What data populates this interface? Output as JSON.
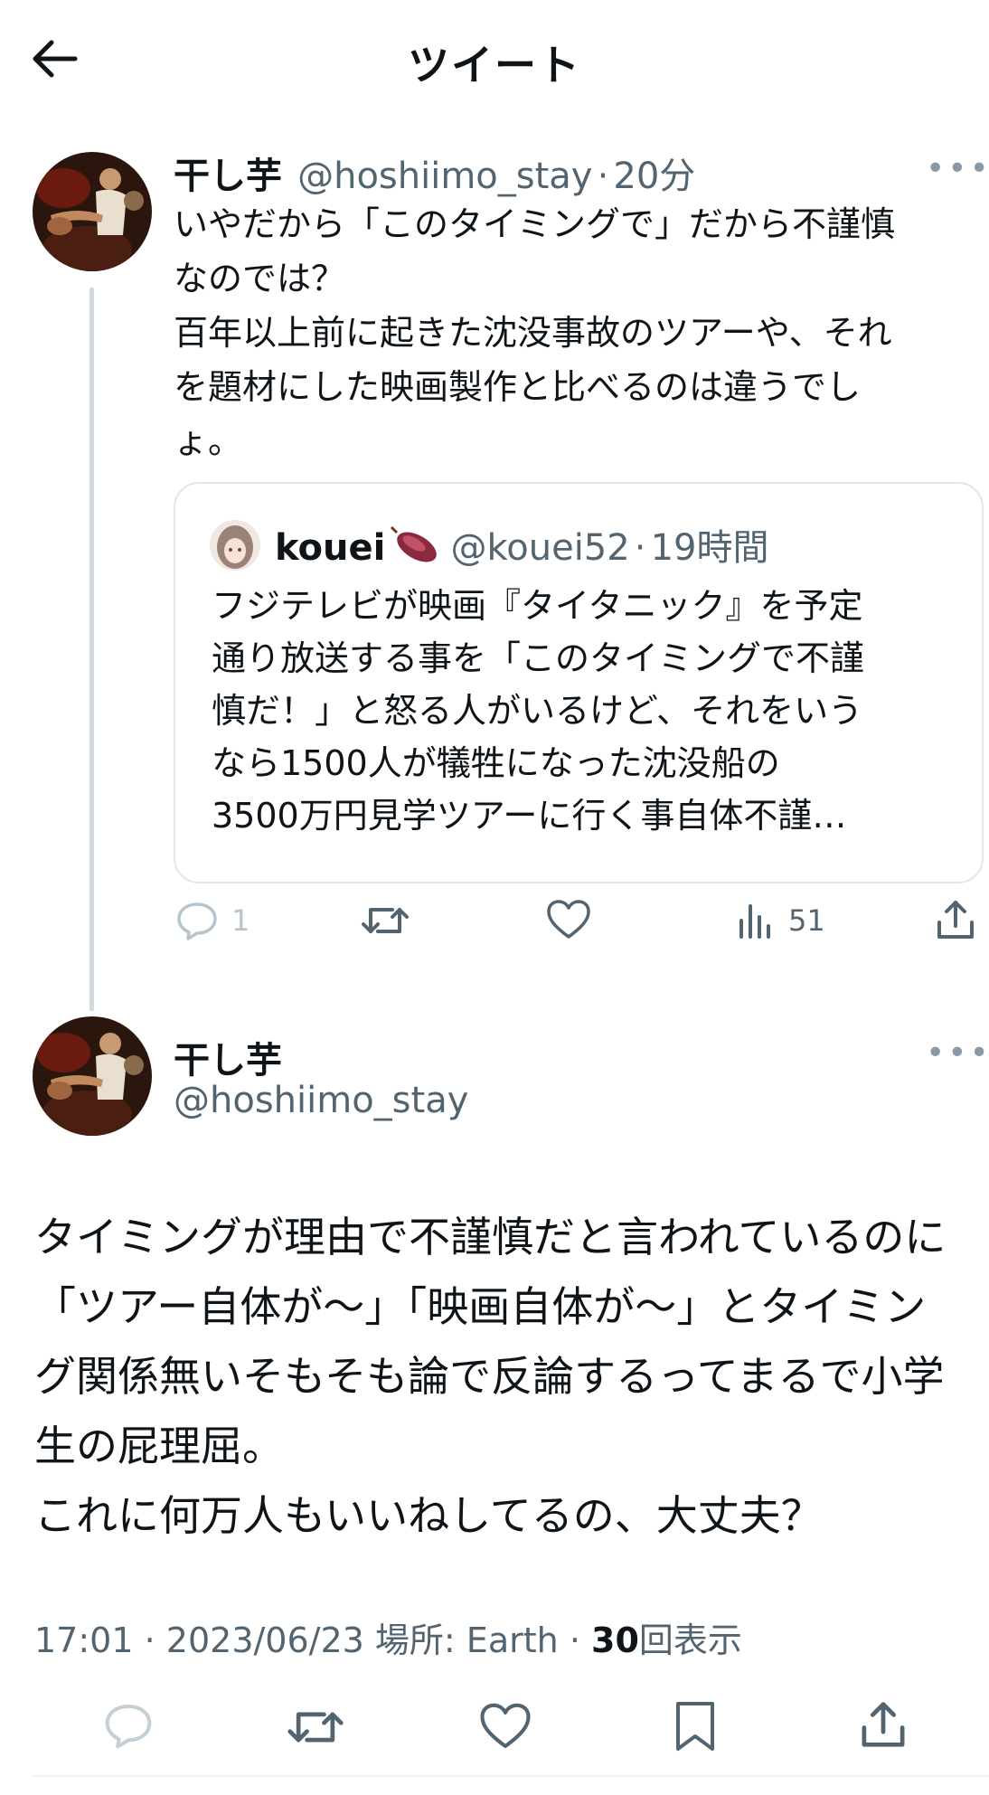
{
  "header": {
    "title": "ツイート"
  },
  "tweet1": {
    "name": "干し芋",
    "handle": "@hoshiimo_stay",
    "time": "20分",
    "text_lines": [
      "いやだから「このタイミングで」だから不謹慎",
      "なのでは？",
      "百年以上前に起きた沈没事故のツアーや、それ",
      "を題材にした映画製作と比べるのは違うでし",
      "ょ。"
    ],
    "quote": {
      "name": "kouei",
      "handle": "@kouei52",
      "time": "19時間",
      "text_lines": [
        "フジテレビが映画『タイタニック』を予定",
        "通り放送する事を「このタイミングで不謹",
        "慎だ！」と怒る人がいるけど、それをいう",
        "なら1500人が犠牲になった沈没船の",
        "3500万円見学ツアーに行く事自体不謹…"
      ]
    },
    "actions": {
      "replies": "1",
      "views": "51"
    }
  },
  "tweet2": {
    "name": "干し芋",
    "handle": "@hoshiimo_stay",
    "text_lines": [
      "タイミングが理由で不謹慎だと言われているのに",
      "「ツアー自体が〜」「映画自体が〜」とタイミン",
      "グ関係無いそもそも論で反論するってまるで小学",
      "生の屁理屈。",
      "これに何万人もいいねしてるの、大丈夫？"
    ],
    "meta": {
      "time": "17:01",
      "date": "2023/06/23",
      "location": "場所: Earth",
      "views_count": "30",
      "views_label": "回表示"
    }
  },
  "colors": {
    "accent": "#1d9bf0",
    "muted": "#536471",
    "border": "#e1e6ea"
  }
}
